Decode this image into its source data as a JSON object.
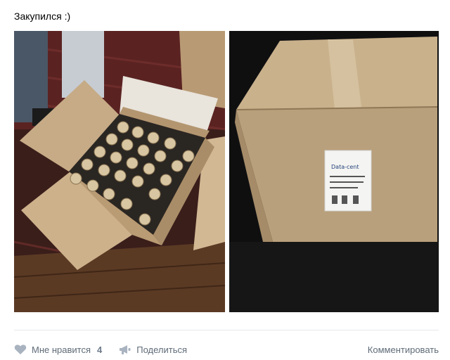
{
  "post": {
    "text": "Закупился :)"
  },
  "photos": [
    {
      "name": "open-box-with-bottles"
    },
    {
      "name": "closed-cardboard-box"
    }
  ],
  "box_label": {
    "brand": "Data-cent"
  },
  "actions": {
    "like_label": "Мне нравится",
    "like_count": "4",
    "share_label": "Поделиться",
    "comment_label": "Комментировать"
  },
  "colors": {
    "background": "#ffffff",
    "divider": "#e7e8ec",
    "action_text": "#828282",
    "icon": "#a9b3c0"
  },
  "icons": {
    "like": "heart-icon",
    "share": "megaphone-icon"
  }
}
